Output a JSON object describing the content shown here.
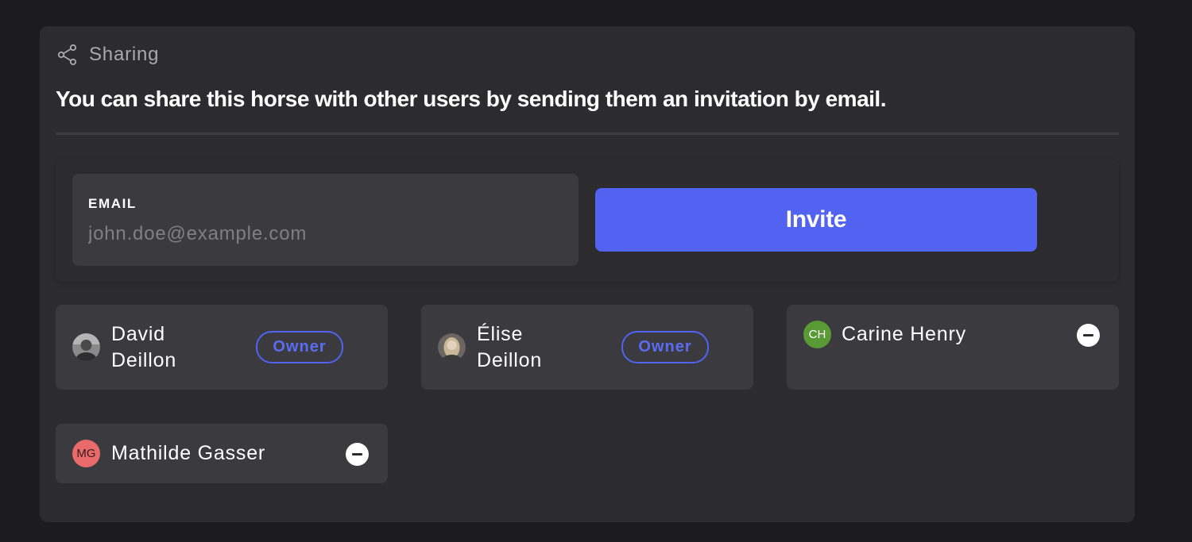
{
  "section": {
    "title": "Sharing",
    "icon": "share-icon"
  },
  "headline": "You can share this horse with other users by sending them an invitation by email.",
  "form": {
    "email_label": "EMAIL",
    "email_placeholder": "john.doe@example.com",
    "email_value": "",
    "invite_label": "Invite"
  },
  "users": [
    {
      "first": "David",
      "last": "Deillon",
      "role": "Owner",
      "avatar_type": "photo"
    },
    {
      "first": "Élise",
      "last": "Deillon",
      "role": "Owner",
      "avatar_type": "photo"
    },
    {
      "name": "Carine Henry",
      "initials": "CH",
      "avatar_color": "#5a9a35",
      "removable": true
    },
    {
      "name": "Mathilde Gasser",
      "initials": "MG",
      "avatar_color": "#e86a6a",
      "removable": true
    }
  ],
  "colors": {
    "accent": "#5163f0",
    "background": "#1c1c1e",
    "panel": "#2c2c2f",
    "card": "#3b3b3f"
  }
}
